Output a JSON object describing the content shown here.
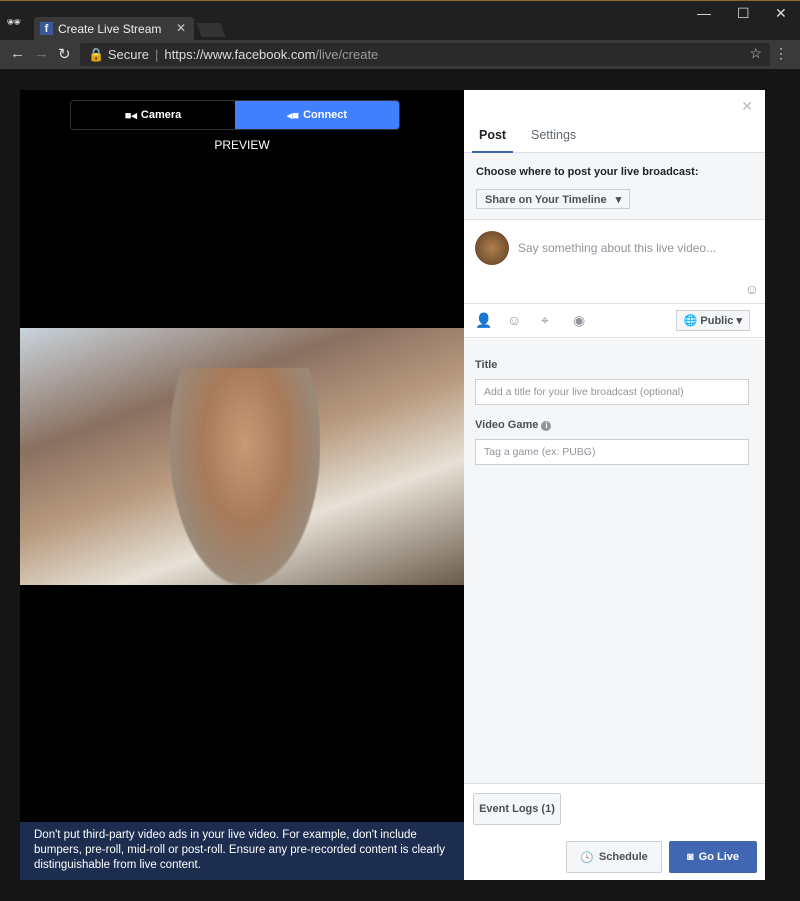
{
  "browser": {
    "tab_title": "Create Live Stream",
    "secure_label": "Secure",
    "url_host": "https://www.facebook.com",
    "url_path": "/live/create"
  },
  "stage": {
    "camera_label": "Camera",
    "connect_label": "Connect",
    "active_mode": "Connect",
    "preview_label": "PREVIEW",
    "accent": "#4080ff",
    "notice": "Don't put third-party video ads in your live video. For example, don't include bumpers, pre-roll, mid-roll or post-roll. Ensure any pre-recorded content is clearly distinguishable from live content."
  },
  "panel": {
    "tabs": [
      {
        "label": "Post",
        "active": true
      },
      {
        "label": "Settings",
        "active": false
      }
    ],
    "where_label": "Choose where to post your live broadcast:",
    "where_value": "Share on Your Timeline",
    "compose_placeholder": "Say something about this live video...",
    "audience": "Public",
    "title_label": "Title",
    "title_placeholder": "Add a title for your live broadcast (optional)",
    "game_label": "Video Game",
    "game_placeholder": "Tag a game (ex: PUBG)",
    "event_logs": "Event Logs (1)",
    "schedule": "Schedule",
    "go_live": "Go Live",
    "brand": "#4267b2"
  }
}
